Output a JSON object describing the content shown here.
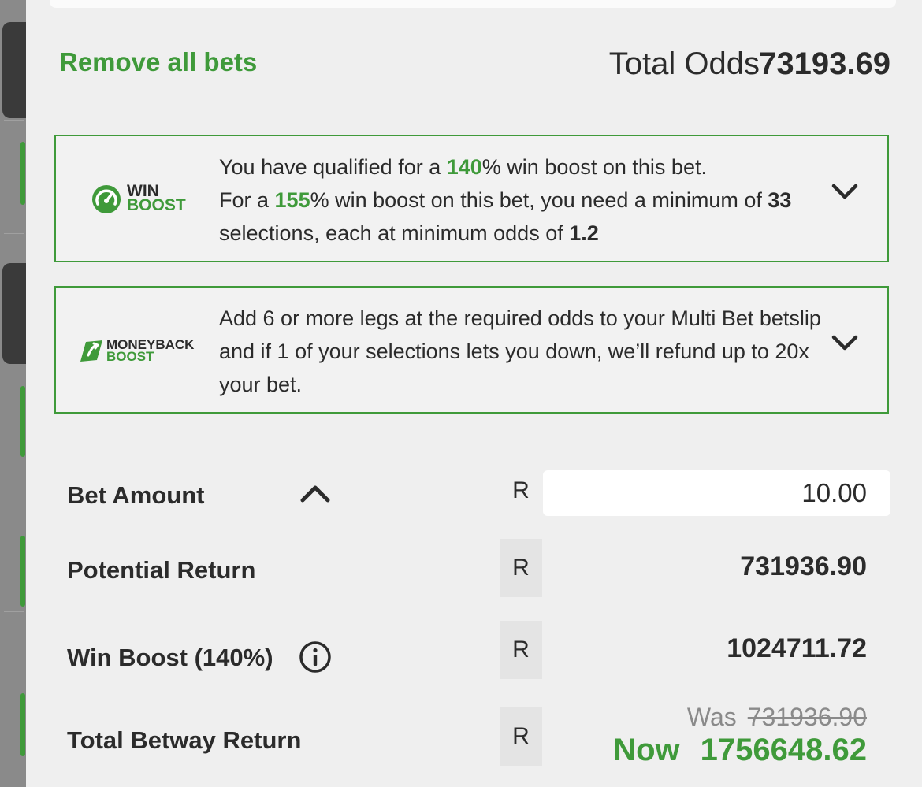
{
  "header": {
    "remove_all_label": "Remove all bets",
    "total_odds_label": "Total Odds",
    "total_odds_value": "73193.69"
  },
  "win_boost": {
    "logo_line1": "WIN",
    "logo_line2": "BOOST",
    "t1": "You have qualified for a ",
    "pct_current": "140",
    "t2": "% win boost on this bet.",
    "t3": "For a ",
    "pct_next": "155",
    "t4": "% win boost on this bet, you need a minimum of ",
    "min_selections": "33",
    "t5": " selections, each at minimum odds of ",
    "min_odds": "1.2"
  },
  "moneyback": {
    "logo_line1": "MONEYBACK",
    "logo_line2": "BOOST",
    "text": "Add 6 or more legs at the required odds to your Multi Bet betslip and if 1 of your selections lets you down, we’ll refund up to 20x your bet."
  },
  "bet": {
    "currency_symbol": "R",
    "bet_amount_label": "Bet Amount",
    "bet_amount_value": "10.00",
    "potential_return_label": "Potential Return",
    "potential_return_value": "731936.90",
    "win_boost_label": "Win Boost (140%)",
    "win_boost_value": "1024711.72",
    "total_return_label": "Total Betway Return",
    "was_label": "Was",
    "was_value": "731936.90",
    "now_label": "Now",
    "now_value": "1756648.62"
  },
  "colors": {
    "accent_green": "#3f9a3a",
    "text_dark": "#2b2b2b",
    "panel_bg": "#efefef"
  },
  "icons": [
    "win-boost-logo-icon",
    "moneyback-boost-logo-icon",
    "chevron-down-icon",
    "chevron-up-icon",
    "info-icon"
  ]
}
